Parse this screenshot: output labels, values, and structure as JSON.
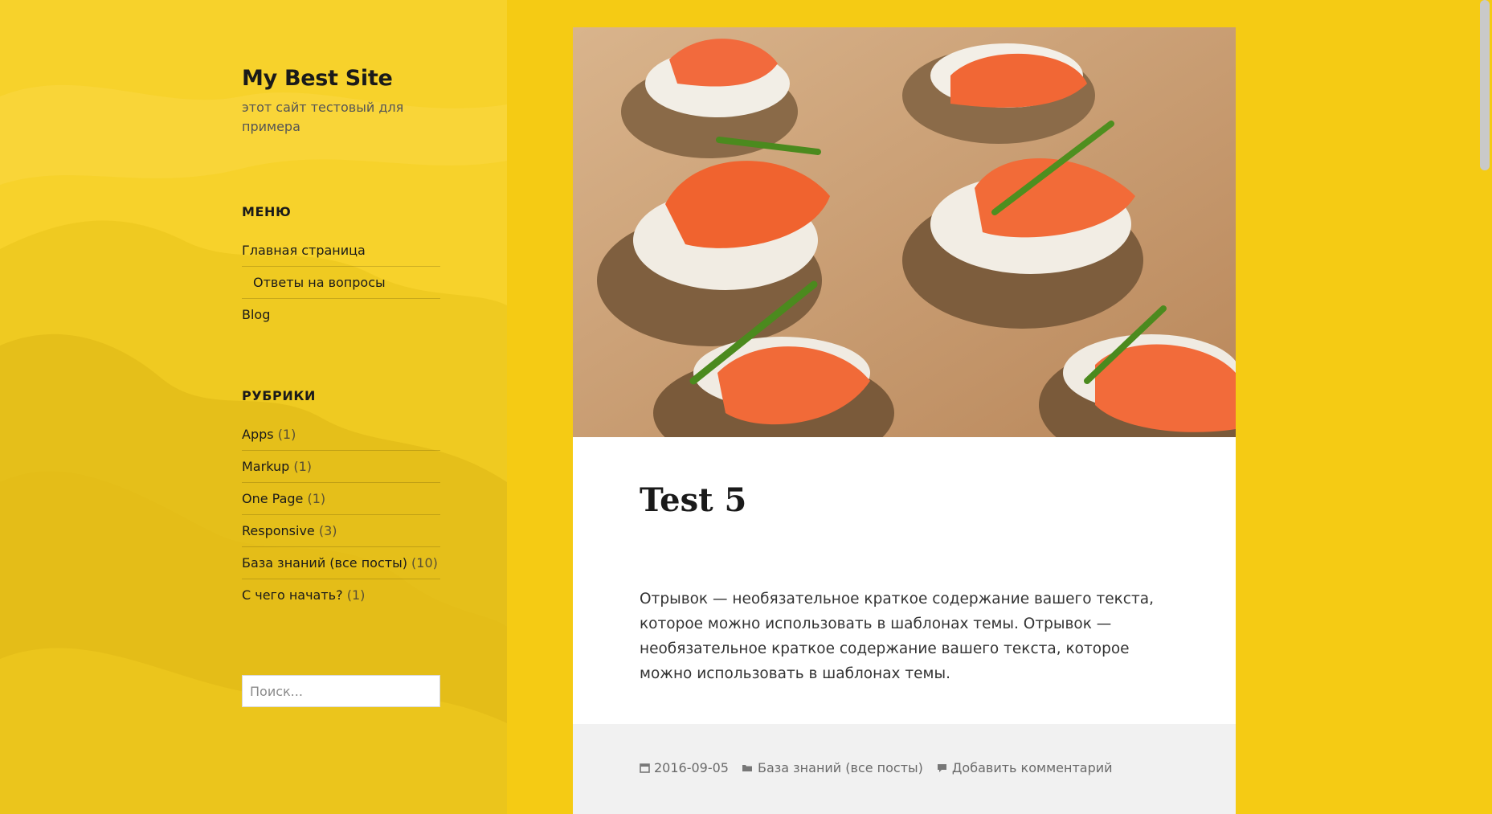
{
  "site": {
    "title": "My Best Site",
    "description": "этот сайт тестовый для примера"
  },
  "menu_widget": {
    "title": "МЕНЮ",
    "items": [
      {
        "label": "Главная страница"
      },
      {
        "label": "Ответы на вопросы"
      },
      {
        "label": "Blog"
      }
    ]
  },
  "categories_widget": {
    "title": "РУБРИКИ",
    "items": [
      {
        "label": "Apps",
        "count": "(1)"
      },
      {
        "label": "Markup",
        "count": "(1)"
      },
      {
        "label": "One Page",
        "count": "(1)"
      },
      {
        "label": "Responsive",
        "count": "(3)"
      },
      {
        "label": "База знаний (все посты)",
        "count": "(10)"
      },
      {
        "label": "С чего начать?",
        "count": "(1)"
      }
    ]
  },
  "search": {
    "placeholder": "Поиск..."
  },
  "post": {
    "title": "Test 5",
    "excerpt": "Отрывок — необязательное краткое содержание вашего текста, которое можно использовать в шаблонах темы. Отрывок — необязательное краткое содержание вашего текста, которое можно использовать в шаблонах темы.",
    "meta": {
      "date": "2016-09-05",
      "category": "База знаний (все посты)",
      "comments": "Добавить комментарий"
    }
  },
  "icons": {
    "date": "calendar-icon",
    "category": "folder-icon",
    "comments": "comment-icon"
  },
  "colors": {
    "background": "#f5cb14",
    "sidebar": "#f7d22b",
    "card": "#ffffff",
    "footer": "#f1f1f1"
  }
}
